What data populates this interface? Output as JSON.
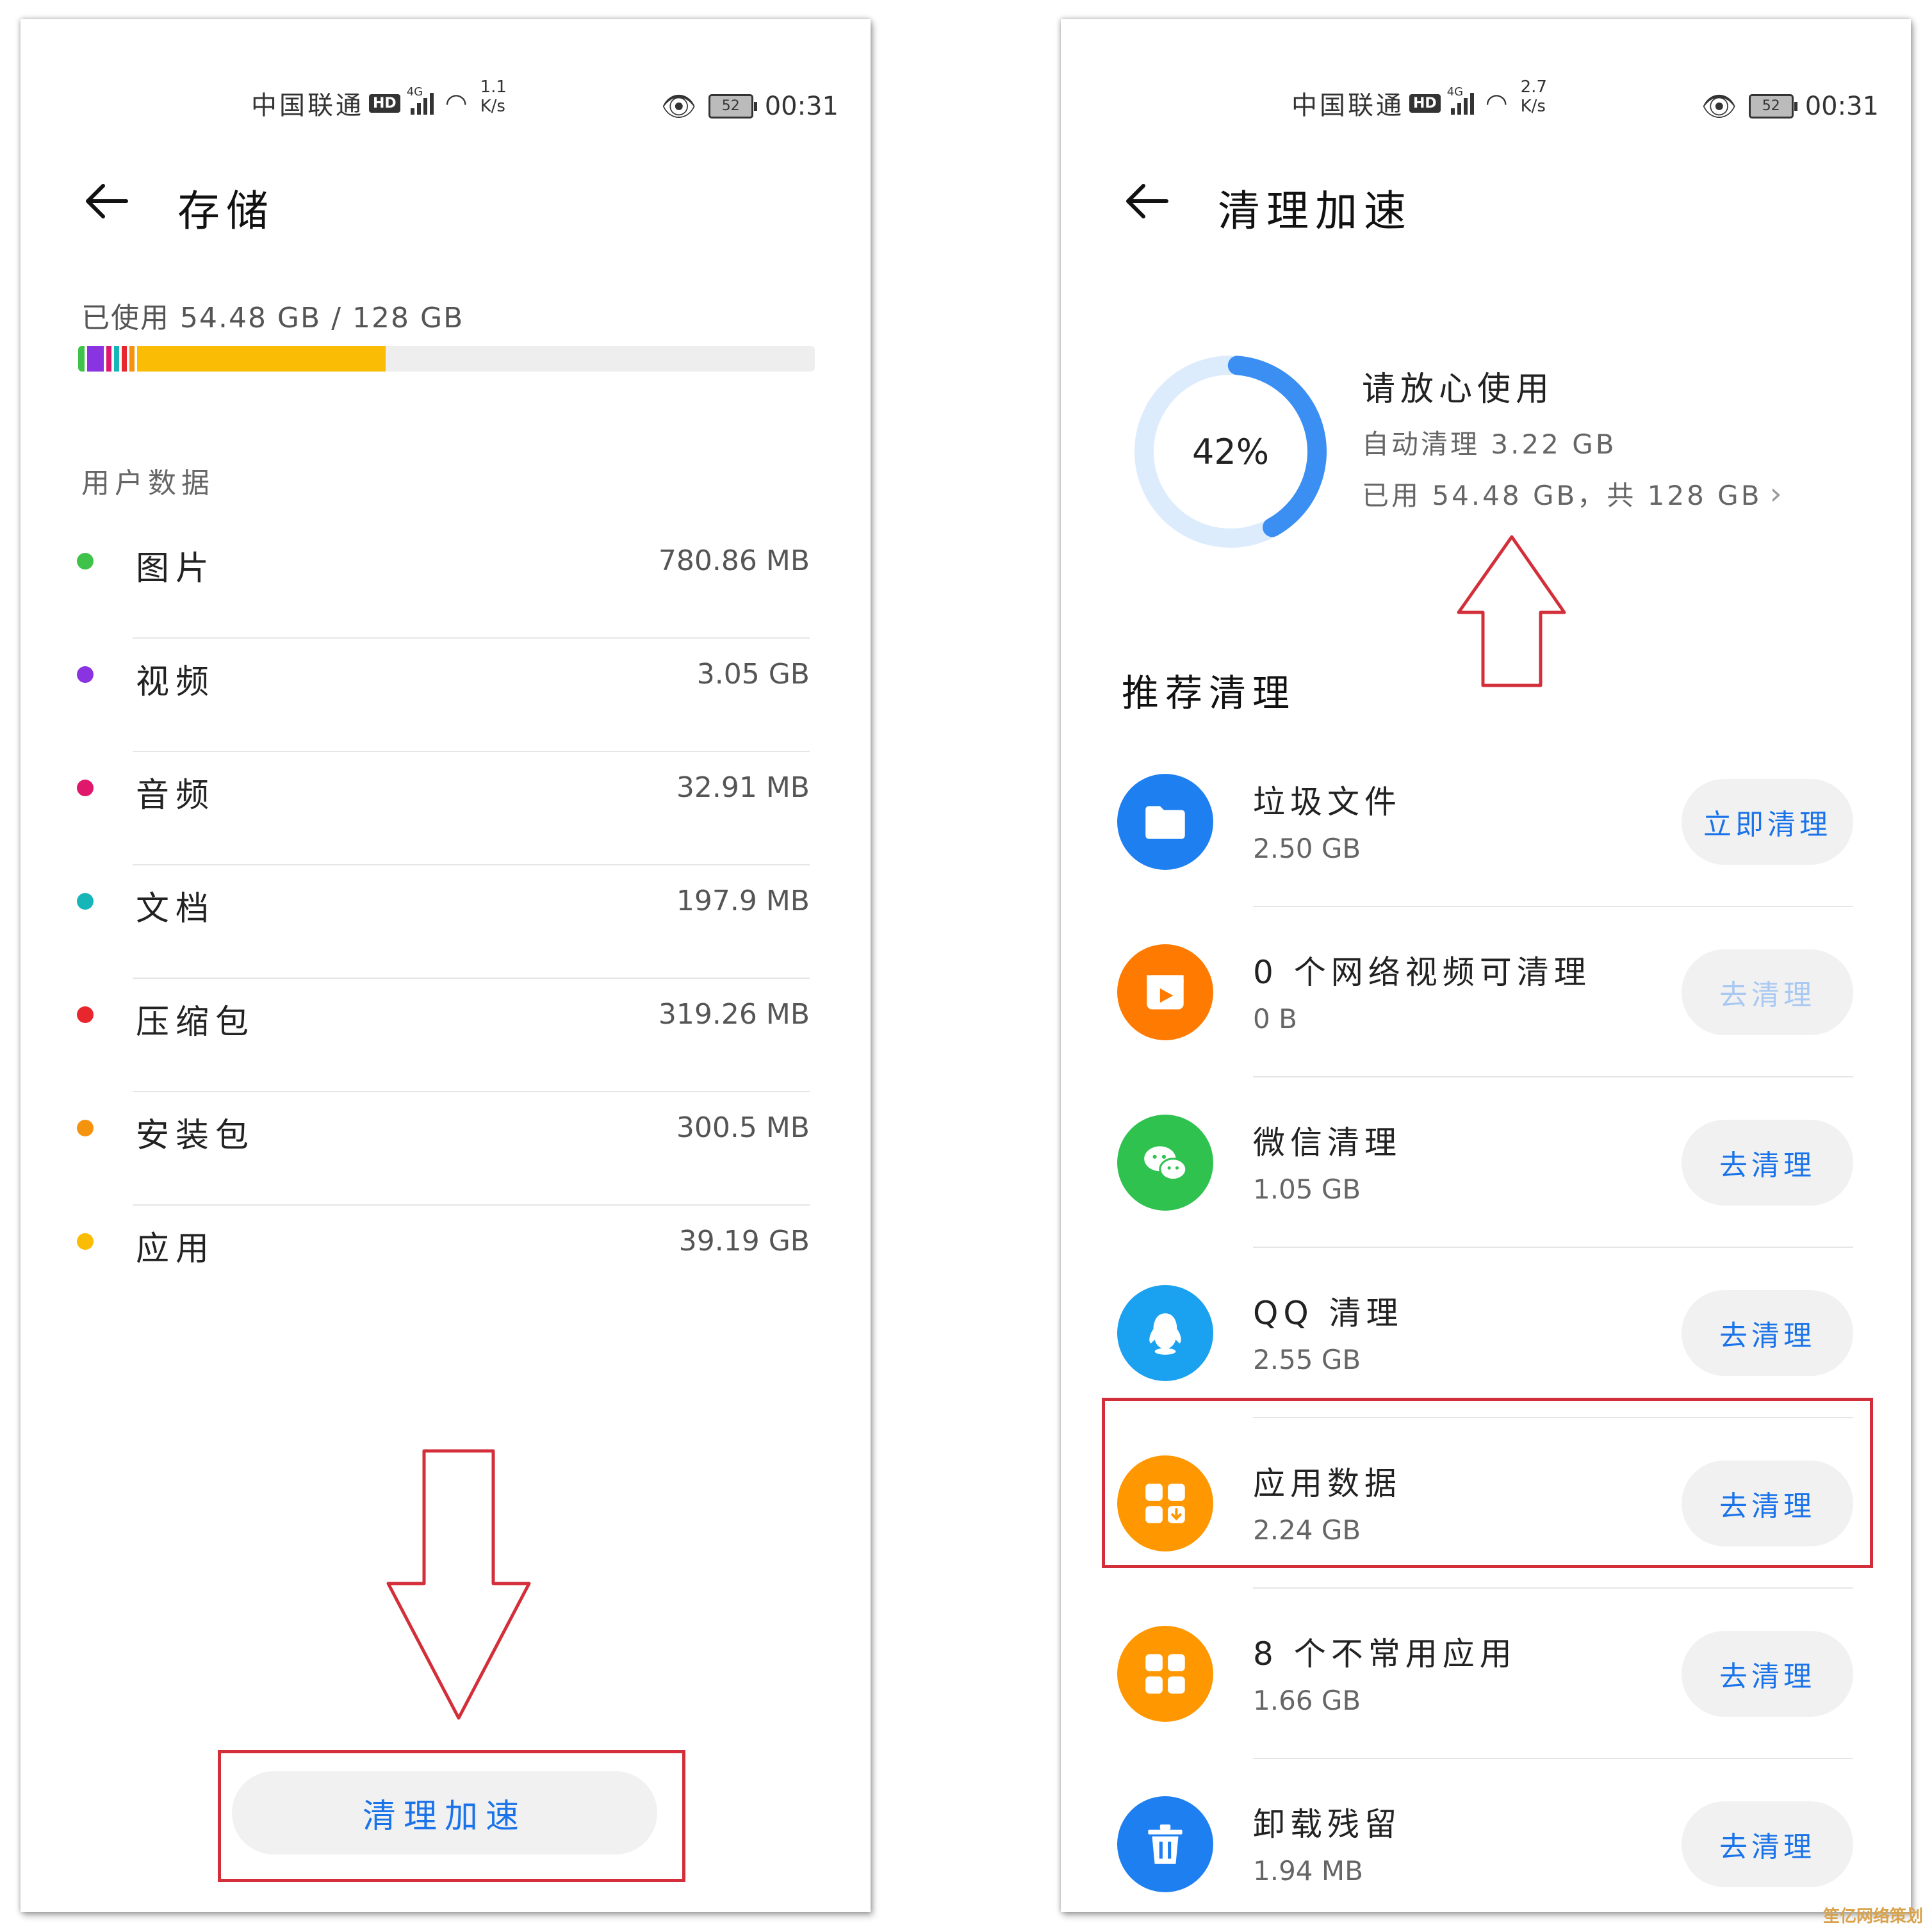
{
  "statusbar_left": {
    "carrier": "中国联通",
    "hd": "HD",
    "net": "4G",
    "speed_value": "1.1",
    "speed_unit": "K/s",
    "battery": "52",
    "time": "00:31"
  },
  "statusbar_right": {
    "carrier": "中国联通",
    "hd": "HD",
    "net": "4G",
    "speed_value": "2.7",
    "speed_unit": "K/s",
    "battery": "52",
    "time": "00:31"
  },
  "storage": {
    "title": "存储",
    "used_text": "已使用 54.48 GB / 128 GB",
    "used_fraction": 0.4256,
    "section_label": "用户数据",
    "categories": [
      {
        "name": "图片",
        "size": "780.86 MB",
        "color": "#3ec24a"
      },
      {
        "name": "视频",
        "size": "3.05 GB",
        "color": "#8a33e0"
      },
      {
        "name": "音频",
        "size": "32.91 MB",
        "color": "#e0186b"
      },
      {
        "name": "文档",
        "size": "197.9 MB",
        "color": "#16b6b8"
      },
      {
        "name": "压缩包",
        "size": "319.26 MB",
        "color": "#e8262e"
      },
      {
        "name": "安装包",
        "size": "300.5 MB",
        "color": "#f5930f"
      },
      {
        "name": "应用",
        "size": "39.19 GB",
        "color": "#fbbc05"
      }
    ],
    "button_label": "清理加速"
  },
  "cleanup": {
    "title": "清理加速",
    "percent_label": "42%",
    "percent_value": 42,
    "summary_title": "请放心使用",
    "auto_cleaned": "自动清理 3.22 GB",
    "used_total": "已用 54.48 GB，共 128 GB",
    "section_title": "推荐清理",
    "items": [
      {
        "name": "垃圾文件",
        "size": "2.50 GB",
        "button": "立即清理",
        "icon": "folder-icon",
        "color": "#1e7ff0",
        "enabled": true
      },
      {
        "name": "0 个网络视频可清理",
        "size": "0 B",
        "button": "去清理",
        "icon": "video-icon",
        "color": "#ff7a00",
        "enabled": false
      },
      {
        "name": "微信清理",
        "size": "1.05 GB",
        "button": "去清理",
        "icon": "wechat-icon",
        "color": "#2fc24f",
        "enabled": true
      },
      {
        "name": "QQ 清理",
        "size": "2.55 GB",
        "button": "去清理",
        "icon": "qq-icon",
        "color": "#1aa1f0",
        "enabled": true
      },
      {
        "name": "应用数据",
        "size": "2.24 GB",
        "button": "去清理",
        "icon": "app-data-icon",
        "color": "#ff9800",
        "enabled": true
      },
      {
        "name": "8 个不常用应用",
        "size": "1.66 GB",
        "button": "去清理",
        "icon": "apps-icon",
        "color": "#ff9800",
        "enabled": true
      },
      {
        "name": "卸载残留",
        "size": "1.94 MB",
        "button": "去清理",
        "icon": "trash-icon",
        "color": "#1e7ff0",
        "enabled": true
      }
    ]
  },
  "watermark": "笙亿网络策划",
  "colors": {
    "accent": "#1a73e8",
    "annotation": "#d32f3a",
    "ring": "#3b8ff3",
    "ring_track": "#ddecfd"
  }
}
